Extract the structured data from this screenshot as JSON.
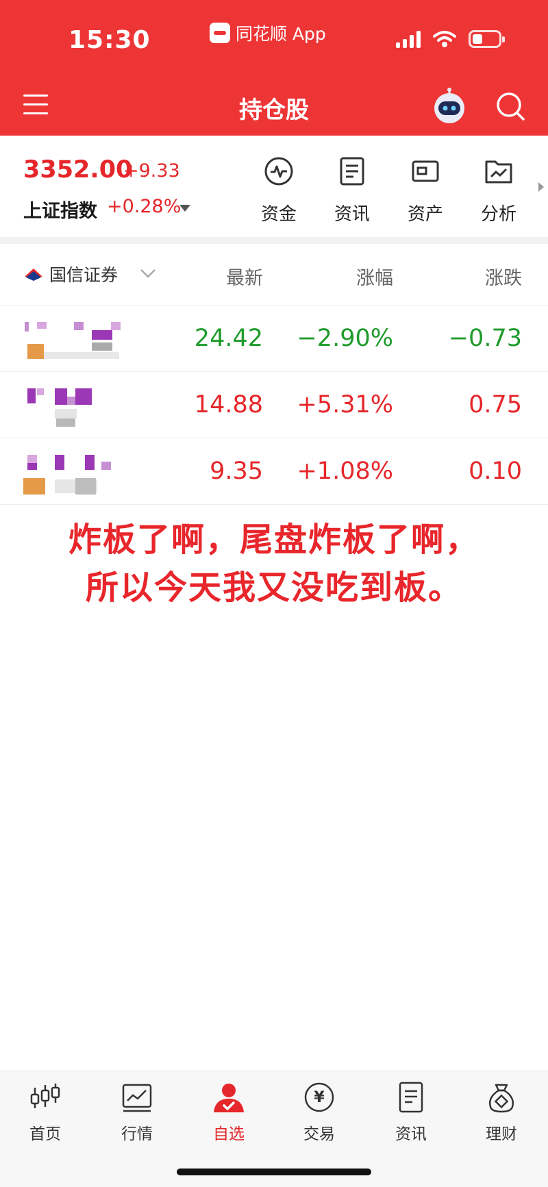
{
  "status_bar": {
    "time": "15:30",
    "source_app": "同花顺 App"
  },
  "nav": {
    "title": "持仓股"
  },
  "index": {
    "price": "3352.00",
    "change": "+9.33",
    "name": "上证指数",
    "pct": "+0.28%"
  },
  "quick_actions": [
    {
      "label": "资金",
      "icon": "fund-flow-icon"
    },
    {
      "label": "资讯",
      "icon": "news-doc-icon"
    },
    {
      "label": "资产",
      "icon": "wallet-icon"
    },
    {
      "label": "分析",
      "icon": "analysis-folder-icon"
    }
  ],
  "holdings": {
    "broker": "国信证券",
    "columns": [
      "最新",
      "涨幅",
      "涨跌"
    ],
    "rows": [
      {
        "latest": "24.42",
        "pct": "−2.90%",
        "change": "−0.73",
        "direction": "down"
      },
      {
        "latest": "14.88",
        "pct": "+5.31%",
        "change": "0.75",
        "direction": "up"
      },
      {
        "latest": "9.35",
        "pct": "+1.08%",
        "change": "0.10",
        "direction": "up"
      }
    ]
  },
  "caption": {
    "line1": "炸板了啊，尾盘炸板了啊，",
    "line2": "所以今天我又没吃到板。"
  },
  "tabs": [
    {
      "label": "首页",
      "icon": "candlestick-icon"
    },
    {
      "label": "行情",
      "icon": "market-chart-icon"
    },
    {
      "label": "自选",
      "icon": "user-check-icon",
      "active": true
    },
    {
      "label": "交易",
      "icon": "yen-icon"
    },
    {
      "label": "资讯",
      "icon": "news-doc-icon"
    },
    {
      "label": "理财",
      "icon": "money-bag-icon"
    }
  ],
  "colors": {
    "brand_red": "#ee3536",
    "rise_red": "#e5262a",
    "fall_green": "#1f9b2c"
  }
}
